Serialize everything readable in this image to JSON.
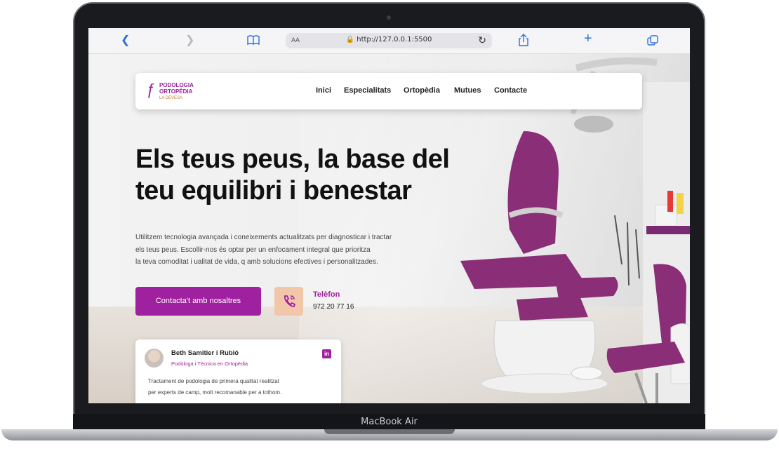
{
  "device": {
    "label": "MacBook Air"
  },
  "browser": {
    "url": "http://127.0.0.1:5500",
    "text_size_label": "AA",
    "icons": [
      "back-icon",
      "forward-icon",
      "book-icon",
      "lock-icon",
      "reload-icon",
      "share-icon",
      "plus-icon",
      "tabs-icon"
    ]
  },
  "nav": {
    "logo": {
      "line1": "PODOLOGIA",
      "line2": "ORTOPÈDIA",
      "line3": "LA DEVESA"
    },
    "items": [
      {
        "label": "Inici"
      },
      {
        "label": "Especialitats"
      },
      {
        "label": "Ortopèdia"
      },
      {
        "label": "Mutues"
      },
      {
        "label": "Contacte"
      }
    ]
  },
  "hero": {
    "title_line1": "Els teus peus, la base del",
    "title_line2": "teu equilibri i benestar",
    "paragraph_line1": "Utilitzem tecnologia avançada i coneixements actualitzats per diagnosticar i tractar",
    "paragraph_line2": "els teus peus. Escollir-nos és optar per un enfocament integral que prioritza",
    "paragraph_line3": "la teva comoditat i ualitat de vida, q amb solucions efectives i personalitzades.",
    "cta_label": "Contacta't amb nosaltres",
    "phone_label": "Telèfon",
    "phone_number": "972 20 77 16"
  },
  "testimonial": {
    "name": "Beth Samitier i Rubió",
    "role": "Podòloga i Tècnica en Ortopèdia",
    "linkedin_label": "in",
    "quote_line1": "Tractament de podologia de primera qualitat realitzat",
    "quote_line2": "per experts de camp, molt recomanable per a tothom."
  },
  "colors": {
    "accent": "#a0219f",
    "phone_bg": "#f2c6a9"
  }
}
